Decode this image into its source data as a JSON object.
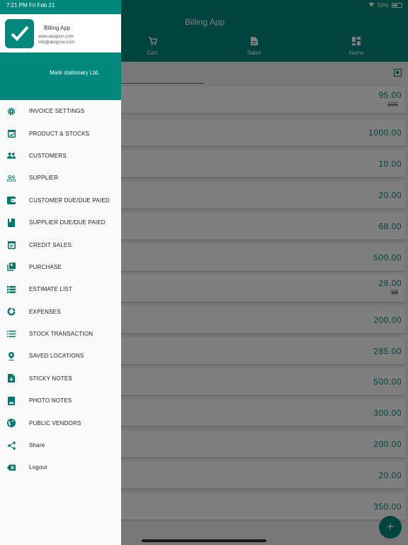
{
  "status_bar": {
    "time": "7:21 PM",
    "date": "Fri Feb 21",
    "battery": "50%"
  },
  "app": {
    "title": "Billing App",
    "tabs": [
      {
        "label": "Cart",
        "icon": "cart-icon"
      },
      {
        "label": "Sales",
        "icon": "document-icon"
      },
      {
        "label": "Home",
        "icon": "dashboard-icon"
      }
    ],
    "products": [
      {
        "price": "95.00",
        "old_price": "100"
      },
      {
        "price": "1000.00",
        "old_price": ""
      },
      {
        "price": "10.00",
        "old_price": ""
      },
      {
        "price": "20.00",
        "old_price": ""
      },
      {
        "price": "68.00",
        "old_price": ""
      },
      {
        "price": "500.00",
        "old_price": ""
      },
      {
        "price": "28.00",
        "old_price": "38"
      },
      {
        "price": "200.00",
        "old_price": ""
      },
      {
        "price": "285.00",
        "old_price": ""
      },
      {
        "price": "500.00",
        "old_price": ""
      },
      {
        "price": "300.00",
        "old_price": ""
      },
      {
        "price": "200.00",
        "old_price": ""
      },
      {
        "price": "20.00",
        "old_price": ""
      },
      {
        "price": "350.00",
        "old_price": ""
      }
    ],
    "fab_label": "+"
  },
  "drawer": {
    "app_name": "Billing App",
    "website": "www.alsignon.com",
    "email": "info@alsignon.com",
    "company": "Mark stationary Ltd.",
    "items": [
      {
        "label": "INVOICE SETTINGS",
        "icon": "gear-icon"
      },
      {
        "label": "PRODUCT & STOCKS",
        "icon": "calendar-check-icon"
      },
      {
        "label": "CUSTOMERS",
        "icon": "people-icon"
      },
      {
        "label": "SUPPLIER",
        "icon": "people-outline-icon"
      },
      {
        "label": "CUSTOMER DUE/DUE PAIED",
        "icon": "wallet-icon"
      },
      {
        "label": "SUPPLIER DUE/DUE PAIED",
        "icon": "book-icon"
      },
      {
        "label": "CREDIT SALES",
        "icon": "calendar-icon"
      },
      {
        "label": "PURCHASE",
        "icon": "library-icon"
      },
      {
        "label": "ESTIMATE LIST",
        "icon": "list-icon"
      },
      {
        "label": "EXPENSES",
        "icon": "donut-icon"
      },
      {
        "label": "STOCK TRANSACTION",
        "icon": "lines-icon"
      },
      {
        "label": "SAVED LOCATIONS",
        "icon": "location-pin-icon"
      },
      {
        "label": "STICKY NOTES",
        "icon": "note-download-icon"
      },
      {
        "label": "PHOTO NOTES",
        "icon": "photo-icon"
      },
      {
        "label": "PUBLIC VENDORS",
        "icon": "globe-icon"
      },
      {
        "label": "Share",
        "icon": "share-icon"
      },
      {
        "label": "Logout",
        "icon": "logout-icon"
      }
    ]
  },
  "colors": {
    "primary": "#00897b",
    "icon": "#00796b"
  }
}
